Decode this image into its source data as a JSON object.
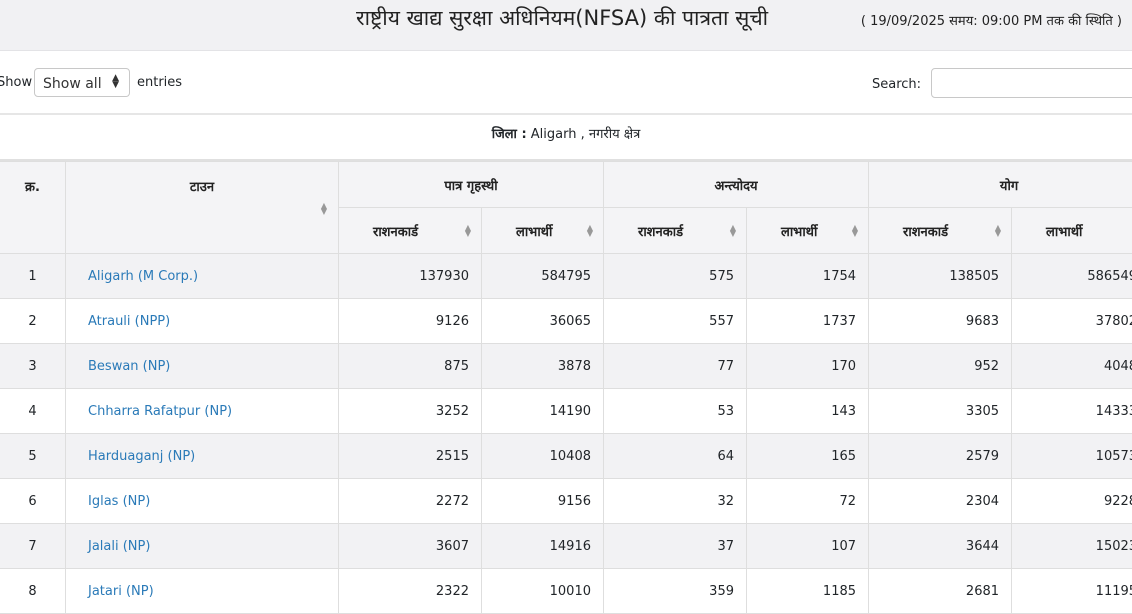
{
  "header": {
    "title": "राष्ट्रीय खाद्य सुरक्षा अधिनियम(NFSA) की पात्रता सूची",
    "status": "( 19/09/2025 समय: 09:00 PM तक की स्थिति )"
  },
  "controls": {
    "show_label": "Show",
    "length_value": "Show all",
    "entries_label": "entries",
    "search_label": "Search:",
    "search_value": ""
  },
  "district": {
    "label": "जिला :",
    "name": "Aligarh",
    "area": ", नगरीय क्षेत्र"
  },
  "table": {
    "headers": {
      "sno": "क्र.",
      "town": "टाउन",
      "group_eligible": "पात्र गृहस्थी",
      "group_antyodaya": "अन्त्योदय",
      "group_total": "योग",
      "rationcard": "राशनकार्ड",
      "beneficiary": "लाभार्थी"
    },
    "rows": [
      {
        "sno": "1",
        "town": "Aligarh (M Corp.)",
        "ph_rc": "137930",
        "ph_ben": "584795",
        "aay_rc": "575",
        "aay_ben": "1754",
        "tot_rc": "138505",
        "tot_ben": "586549"
      },
      {
        "sno": "2",
        "town": "Atrauli (NPP)",
        "ph_rc": "9126",
        "ph_ben": "36065",
        "aay_rc": "557",
        "aay_ben": "1737",
        "tot_rc": "9683",
        "tot_ben": "37802"
      },
      {
        "sno": "3",
        "town": "Beswan (NP)",
        "ph_rc": "875",
        "ph_ben": "3878",
        "aay_rc": "77",
        "aay_ben": "170",
        "tot_rc": "952",
        "tot_ben": "4048"
      },
      {
        "sno": "4",
        "town": "Chharra Rafatpur (NP)",
        "ph_rc": "3252",
        "ph_ben": "14190",
        "aay_rc": "53",
        "aay_ben": "143",
        "tot_rc": "3305",
        "tot_ben": "14333"
      },
      {
        "sno": "5",
        "town": "Harduaganj (NP)",
        "ph_rc": "2515",
        "ph_ben": "10408",
        "aay_rc": "64",
        "aay_ben": "165",
        "tot_rc": "2579",
        "tot_ben": "10573"
      },
      {
        "sno": "6",
        "town": "Iglas (NP)",
        "ph_rc": "2272",
        "ph_ben": "9156",
        "aay_rc": "32",
        "aay_ben": "72",
        "tot_rc": "2304",
        "tot_ben": "9228"
      },
      {
        "sno": "7",
        "town": "Jalali (NP)",
        "ph_rc": "3607",
        "ph_ben": "14916",
        "aay_rc": "37",
        "aay_ben": "107",
        "tot_rc": "3644",
        "tot_ben": "15023"
      },
      {
        "sno": "8",
        "town": "Jatari (NP)",
        "ph_rc": "2322",
        "ph_ben": "10010",
        "aay_rc": "359",
        "aay_ben": "1185",
        "tot_rc": "2681",
        "tot_ben": "11195"
      }
    ]
  }
}
